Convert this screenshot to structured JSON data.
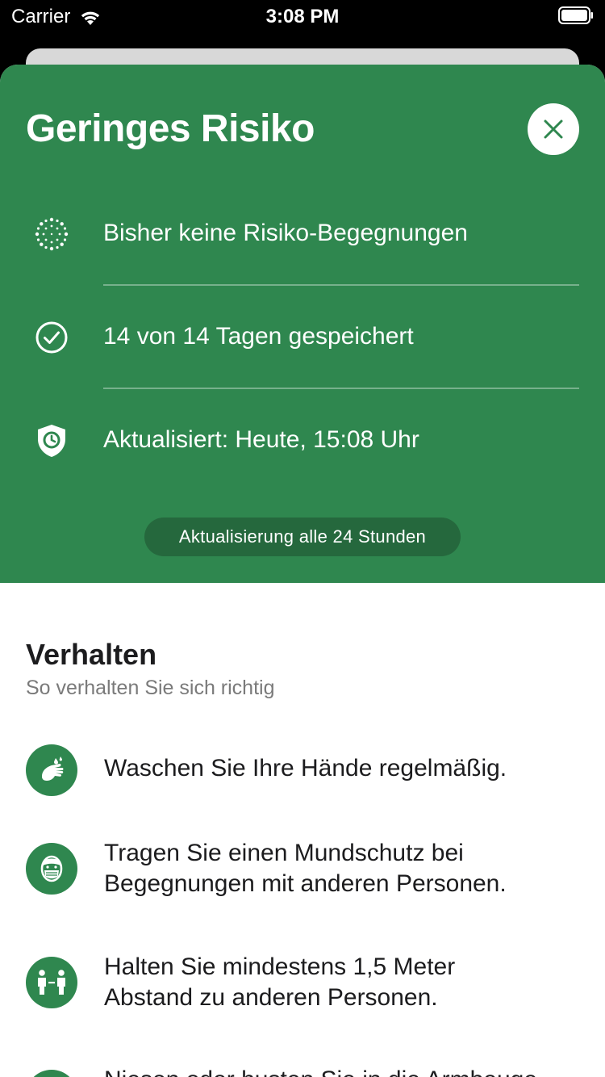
{
  "status_bar": {
    "carrier": "Carrier",
    "time": "3:08 PM"
  },
  "risk": {
    "title": "Geringes Risiko",
    "rows": [
      {
        "text": "Bisher keine Risiko-Begegnungen",
        "icon": "radar-dots-icon"
      },
      {
        "text": "14 von 14 Tagen gespeichert",
        "icon": "check-circle-icon"
      },
      {
        "text": "Aktualisiert: Heute, 15:08 Uhr",
        "icon": "shield-clock-icon"
      }
    ],
    "refresh_label": "Aktualisierung alle 24 Stunden"
  },
  "behavior": {
    "title": "Verhalten",
    "subtitle": "So verhalten Sie sich richtig",
    "items": [
      {
        "line1": "Waschen Sie Ihre Hände regelmäßig.",
        "line2": "",
        "icon": "hand-wash-icon"
      },
      {
        "line1": "Tragen Sie einen Mundschutz bei",
        "line2": "Begegnungen mit anderen Personen.",
        "icon": "face-mask-icon"
      },
      {
        "line1": "Halten Sie mindestens 1,5 Meter",
        "line2": "Abstand zu anderen Personen.",
        "icon": "distance-icon"
      },
      {
        "line1": "Niesen oder husten Sie in die Armbeuge",
        "line2": "",
        "icon": "sneeze-icon"
      }
    ]
  },
  "colors": {
    "primary": "#2f874f",
    "primary_dark": "#25683d",
    "text": "#1c1c1e",
    "secondary_text": "#7a7a7a"
  }
}
